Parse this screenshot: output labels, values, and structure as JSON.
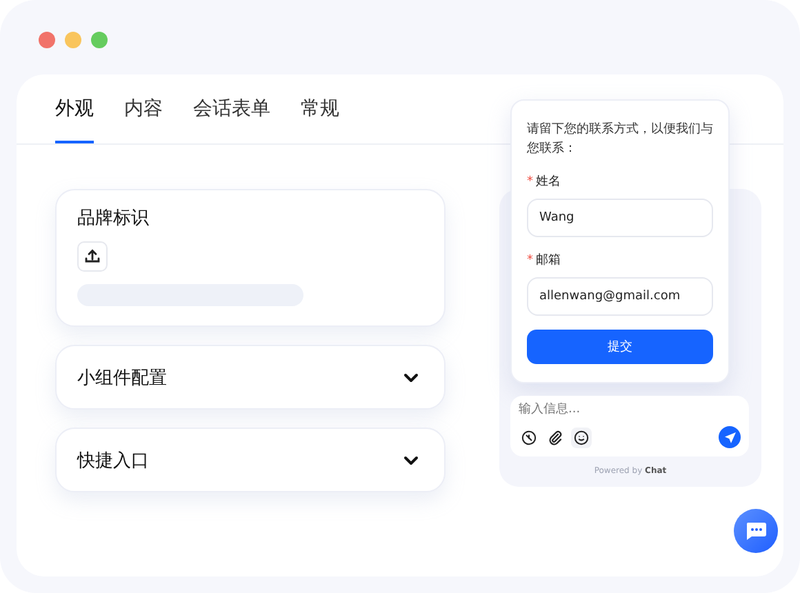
{
  "tabs": [
    {
      "label": "外观",
      "selected": true
    },
    {
      "label": "内容",
      "selected": false
    },
    {
      "label": "会话表单",
      "selected": false
    },
    {
      "label": "常规",
      "selected": false
    }
  ],
  "cards": [
    {
      "kind": "upload",
      "title": "品牌标识"
    },
    {
      "kind": "collapsible",
      "title": "小组件配置",
      "expanded": false
    },
    {
      "kind": "collapsible",
      "title": "快捷入口",
      "expanded": false
    }
  ],
  "chat": {
    "form": {
      "intro": "请留下您的联系方式，以便我们与您联系：",
      "fields": [
        {
          "label": "姓名",
          "required": true,
          "value": "Wang"
        },
        {
          "label": "邮箱",
          "required": true,
          "value": "allenwang@gmail.com"
        }
      ],
      "submit": "提交",
      "required_mark": "*"
    },
    "message": {
      "placeholder": "输入信息..."
    },
    "powered_by": "Powered by **Chat**"
  }
}
